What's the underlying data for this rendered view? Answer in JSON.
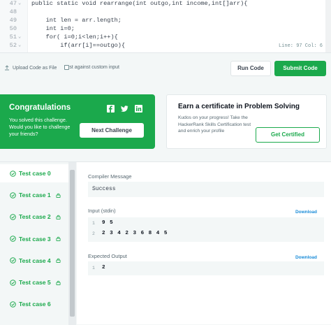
{
  "editor": {
    "lines": [
      {
        "num": "47",
        "fold": "⌄",
        "code": "public static void rearrange(int outgo,int income,int[]arr){"
      },
      {
        "num": "48",
        "fold": "",
        "code": ""
      },
      {
        "num": "49",
        "fold": "",
        "code": "    int len = arr.length;"
      },
      {
        "num": "50",
        "fold": "",
        "code": "    int i=0;"
      },
      {
        "num": "51",
        "fold": "⌄",
        "code": "    for( i=0;i<len;i++){"
      },
      {
        "num": "52",
        "fold": "⌄",
        "code": "        if(arr[i]==outgo){"
      }
    ],
    "status": "Line: 97 Col: 6"
  },
  "toolbar": {
    "upload_label": "Upload Code as File",
    "custom_input_label": "Test against custom input",
    "run_label": "Run Code",
    "submit_label": "Submit Code"
  },
  "congrats": {
    "title": "Congratulations",
    "message": "You solved this challenge. Would you like to challenge your friends?",
    "next_label": "Next Challenge",
    "social": [
      "facebook-icon",
      "twitter-icon",
      "linkedin-icon"
    ]
  },
  "certificate": {
    "title": "Earn a certificate in Problem Solving",
    "message": "Kudos on your progress! Take the HackerRank Skills Certification test and enrich your profile",
    "button_label": "Get Certified"
  },
  "test_cases": [
    {
      "label": "Test case 0",
      "locked": false,
      "active": true
    },
    {
      "label": "Test case 1",
      "locked": true,
      "active": false
    },
    {
      "label": "Test case 2",
      "locked": true,
      "active": false
    },
    {
      "label": "Test case 3",
      "locked": true,
      "active": false
    },
    {
      "label": "Test case 4",
      "locked": true,
      "active": false
    },
    {
      "label": "Test case 5",
      "locked": true,
      "active": false
    },
    {
      "label": "Test case 6",
      "locked": false,
      "active": false
    }
  ],
  "result": {
    "compiler_label": "Compiler Message",
    "compiler_message": "Success",
    "input_label": "Input (stdin)",
    "download_label": "Download",
    "input_lines": [
      {
        "n": "1",
        "v": "9 5"
      },
      {
        "n": "2",
        "v": "2 3 4 2 3 6 8 4 5"
      }
    ],
    "expected_label": "Expected Output",
    "expected_lines": [
      {
        "n": "1",
        "v": "2"
      }
    ]
  },
  "colors": {
    "accent": "#1ba94c",
    "link": "#1a8cd8"
  }
}
